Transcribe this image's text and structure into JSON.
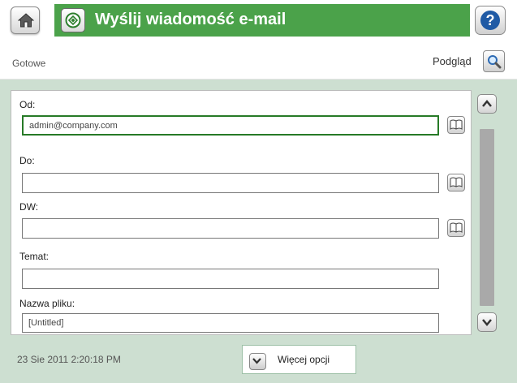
{
  "header": {
    "title": "Wyślij wiadomość e-mail",
    "home_icon": "home-icon",
    "title_icon": "scan-to-email-icon",
    "help_icon": "help-icon",
    "help_symbol": "?"
  },
  "status": {
    "text": "Gotowe",
    "preview_label": "Podgląd",
    "preview_icon": "magnifier-icon"
  },
  "form": {
    "from": {
      "label": "Od:",
      "value": "admin@company.com"
    },
    "to": {
      "label": "Do:",
      "value": ""
    },
    "cc": {
      "label": "DW:",
      "value": ""
    },
    "subject": {
      "label": "Temat:",
      "value": ""
    },
    "filename": {
      "label": "Nazwa pliku:",
      "value": "[Untitled]"
    }
  },
  "footer": {
    "datetime": "23 Sie 2011 2:20:18 PM",
    "more_options": "Więcej opcji"
  },
  "colors": {
    "title_bar": "#4ba24a",
    "background": "#cddfd1",
    "active_field_border": "#277a27"
  }
}
